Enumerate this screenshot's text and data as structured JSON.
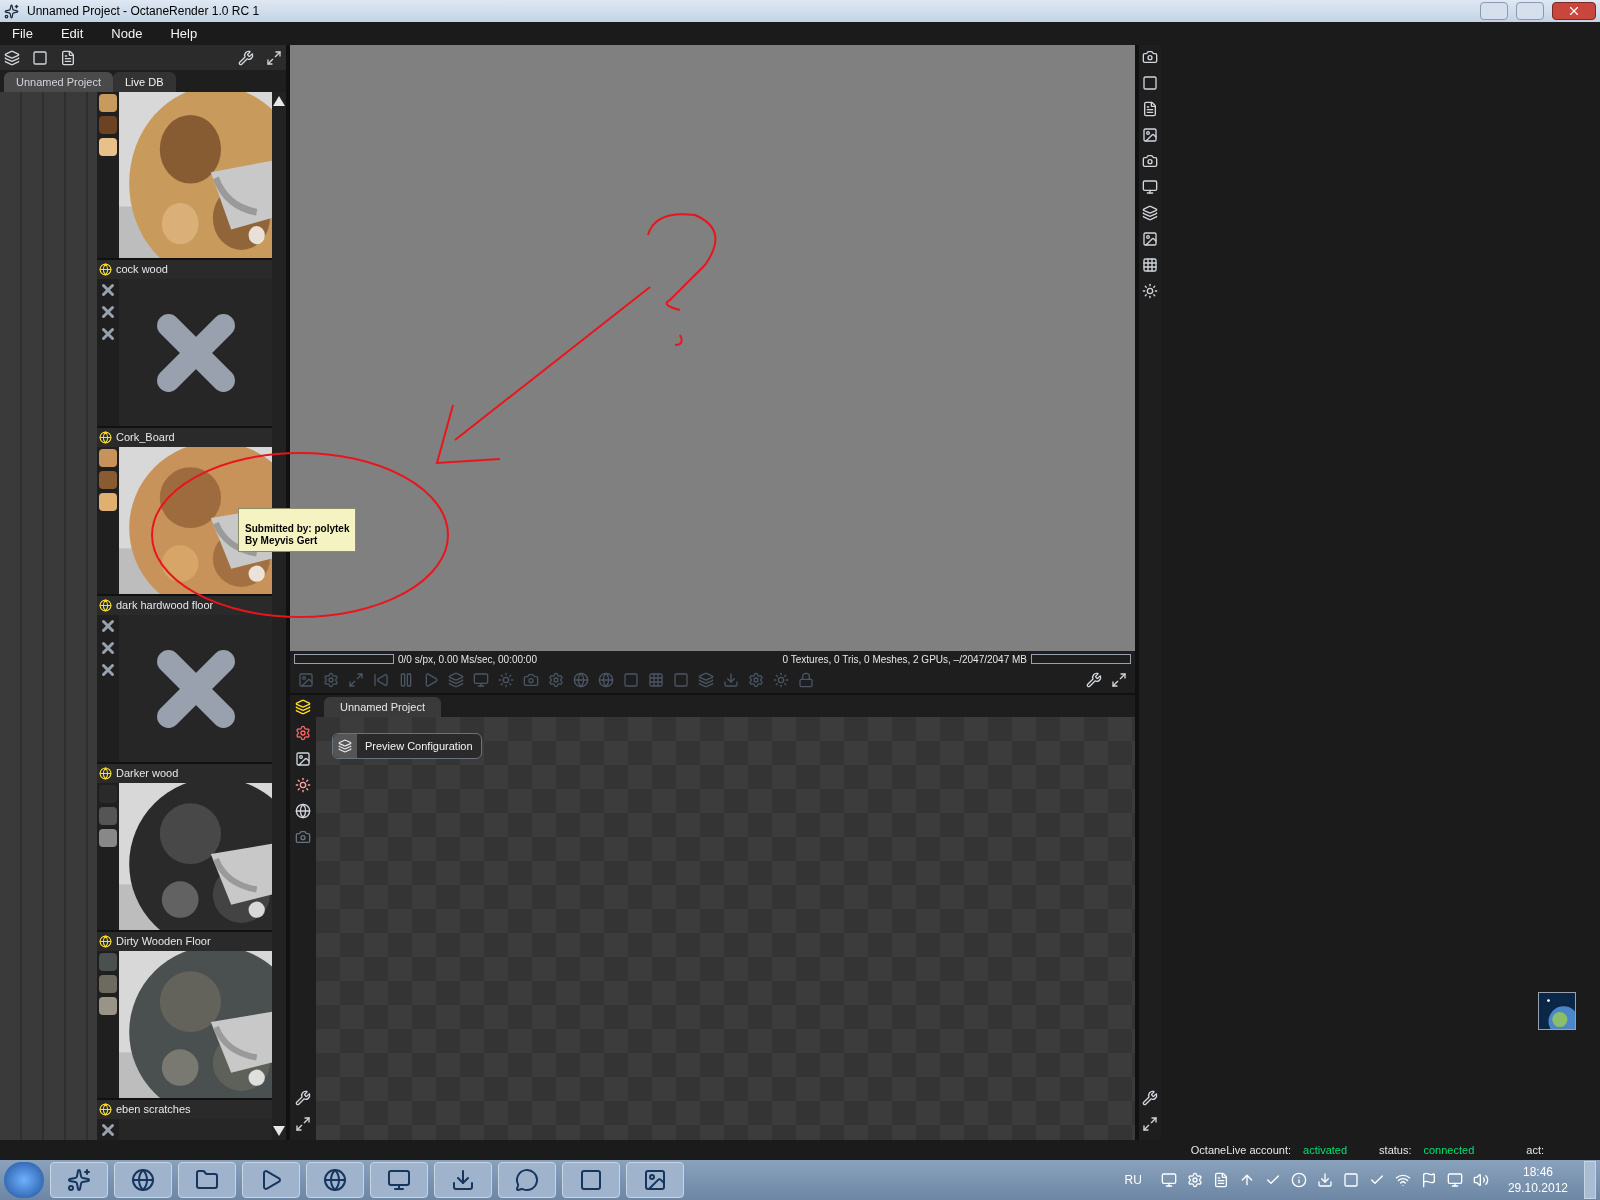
{
  "window": {
    "title": "Unnamed Project - OctaneRender 1.0 RC 1"
  },
  "menu": [
    "File",
    "Edit",
    "Node",
    "Help"
  ],
  "left_panel": {
    "tabs": [
      {
        "label": "Unnamed Project",
        "selected": false
      },
      {
        "label": "Live DB",
        "selected": true
      }
    ],
    "materials": [
      {
        "kind": "picture"
      },
      {
        "name": "cock wood",
        "kind": "missing"
      },
      {
        "name": "Cork_Board",
        "kind": "picture"
      },
      {
        "name": "dark hardwood floor",
        "kind": "missing"
      },
      {
        "name": "Darker wood",
        "kind": "picture"
      },
      {
        "name": "Dirty Wooden Floor",
        "kind": "picture"
      },
      {
        "name": "eben scratches",
        "kind": "missing"
      }
    ],
    "tooltip": {
      "lines": [
        "Submitted by: polytek",
        "By Meyvis Gert"
      ]
    }
  },
  "render": {
    "progress": {
      "level": 0
    },
    "memory": {
      "level": 0
    },
    "stats_left": "0/0 s/px, 0.00 Ms/sec, 00:00:00",
    "stats_right": "0 Textures, 0 Tris, 0 Meshes, 2 GPUs, –/2047/2047 MB"
  },
  "node_editor": {
    "tabs": [
      {
        "label": "Unnamed Project",
        "selected": true
      }
    ],
    "nodes": [
      {
        "label": "Preview Configuration"
      }
    ]
  },
  "status_bar": {
    "account_label": "OctaneLive account:",
    "account_value": "activated",
    "status_label": "status:",
    "status_value": "connected",
    "act_label": "act:"
  },
  "taskbar": {
    "language": "RU",
    "time": "18:46",
    "date": "29.10.2012"
  }
}
